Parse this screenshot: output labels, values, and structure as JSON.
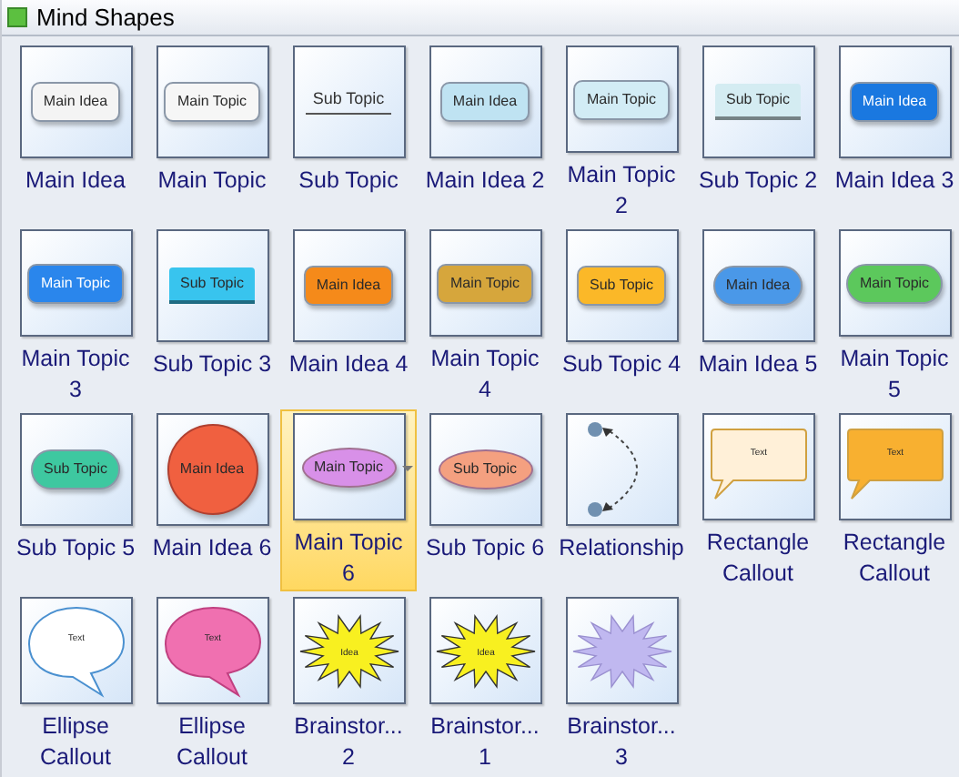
{
  "panel": {
    "title": "Mind Shapes"
  },
  "shapes": [
    {
      "label_lines": [
        "Main Idea"
      ],
      "selected": false,
      "kind": "pill",
      "preview_text": "Main Idea",
      "color": "#f4f4f4"
    },
    {
      "label_lines": [
        "Main Topic"
      ],
      "selected": false,
      "kind": "pill",
      "preview_text": "Main Topic",
      "color": "#f6f6f6"
    },
    {
      "label_lines": [
        "Sub Topic"
      ],
      "selected": false,
      "kind": "underline",
      "preview_text": "Sub Topic",
      "color": "#555555"
    },
    {
      "label_lines": [
        "Main Idea 2"
      ],
      "selected": false,
      "kind": "pill",
      "preview_text": "Main Idea",
      "color": "#bfe3f2"
    },
    {
      "label_lines": [
        "Main Topic",
        "2"
      ],
      "selected": false,
      "kind": "pill",
      "preview_text": "Main Topic",
      "color": "#d2ecf5"
    },
    {
      "label_lines": [
        "Sub Topic 2"
      ],
      "selected": false,
      "kind": "bar",
      "preview_text": "Sub Topic",
      "color": "#d4ecf2"
    },
    {
      "label_lines": [
        "Main Idea 3"
      ],
      "selected": false,
      "kind": "pill",
      "preview_text": "Main Idea",
      "color": "#1a78e0"
    },
    {
      "label_lines": [
        "Main Topic",
        "3"
      ],
      "selected": false,
      "kind": "pill",
      "preview_text": "Main Topic",
      "color": "#2a86ec"
    },
    {
      "label_lines": [
        "Sub Topic 3"
      ],
      "selected": false,
      "kind": "bar",
      "preview_text": "Sub Topic",
      "color": "#38c4ee"
    },
    {
      "label_lines": [
        "Main Idea 4"
      ],
      "selected": false,
      "kind": "pill",
      "preview_text": "Main Idea",
      "color": "#f58a1a"
    },
    {
      "label_lines": [
        "Main Topic",
        "4"
      ],
      "selected": false,
      "kind": "pill",
      "preview_text": "Main Topic",
      "color": "#d6a63c"
    },
    {
      "label_lines": [
        "Sub Topic 4"
      ],
      "selected": false,
      "kind": "pill",
      "preview_text": "Sub Topic",
      "color": "#fbb828"
    },
    {
      "label_lines": [
        "Main Idea 5"
      ],
      "selected": false,
      "kind": "capsule",
      "preview_text": "Main Idea",
      "color": "#4a98e8"
    },
    {
      "label_lines": [
        "Main Topic",
        "5"
      ],
      "selected": false,
      "kind": "capsule",
      "preview_text": "Main Topic",
      "color": "#5cc85c"
    },
    {
      "label_lines": [
        "Sub Topic 5"
      ],
      "selected": false,
      "kind": "capsule",
      "preview_text": "Sub Topic",
      "color": "#3ec8a0"
    },
    {
      "label_lines": [
        "Main Idea 6"
      ],
      "selected": false,
      "kind": "circle",
      "preview_text": "Main Idea",
      "color": "#f06040"
    },
    {
      "label_lines": [
        "Main Topic",
        "6"
      ],
      "selected": true,
      "kind": "ellipse",
      "preview_text": "Main Topic",
      "color": "#d890e8"
    },
    {
      "label_lines": [
        "Sub Topic 6"
      ],
      "selected": false,
      "kind": "ellipse",
      "preview_text": "Sub Topic",
      "color": "#f4a080"
    },
    {
      "label_lines": [
        "Relationship"
      ],
      "selected": false,
      "kind": "relationship",
      "color": "#7090b0"
    },
    {
      "label_lines": [
        "Rectangle",
        "Callout"
      ],
      "selected": false,
      "kind": "rect-callout",
      "preview_text": "Text",
      "color": "#fff0d8"
    },
    {
      "label_lines": [
        "Rectangle",
        "Callout"
      ],
      "selected": false,
      "kind": "rect-callout",
      "preview_text": "Text",
      "color": "#f8b030"
    },
    {
      "label_lines": [
        "Ellipse",
        "Callout"
      ],
      "selected": false,
      "kind": "ellipse-callout",
      "preview_text": "Text",
      "color": "#ffffff"
    },
    {
      "label_lines": [
        "Ellipse",
        "Callout"
      ],
      "selected": false,
      "kind": "ellipse-callout",
      "preview_text": "Text",
      "color": "#f070b0"
    },
    {
      "label_lines": [
        "Brainstor...",
        "2"
      ],
      "selected": false,
      "kind": "starburst",
      "preview_text": "Idea",
      "color": "#f8f020"
    },
    {
      "label_lines": [
        "Brainstor...",
        "1"
      ],
      "selected": false,
      "kind": "starburst",
      "preview_text": "Idea",
      "color": "#f8f020"
    },
    {
      "label_lines": [
        "Brainstor...",
        "3"
      ],
      "selected": false,
      "kind": "starburst",
      "color": "#c0b8f0"
    }
  ]
}
